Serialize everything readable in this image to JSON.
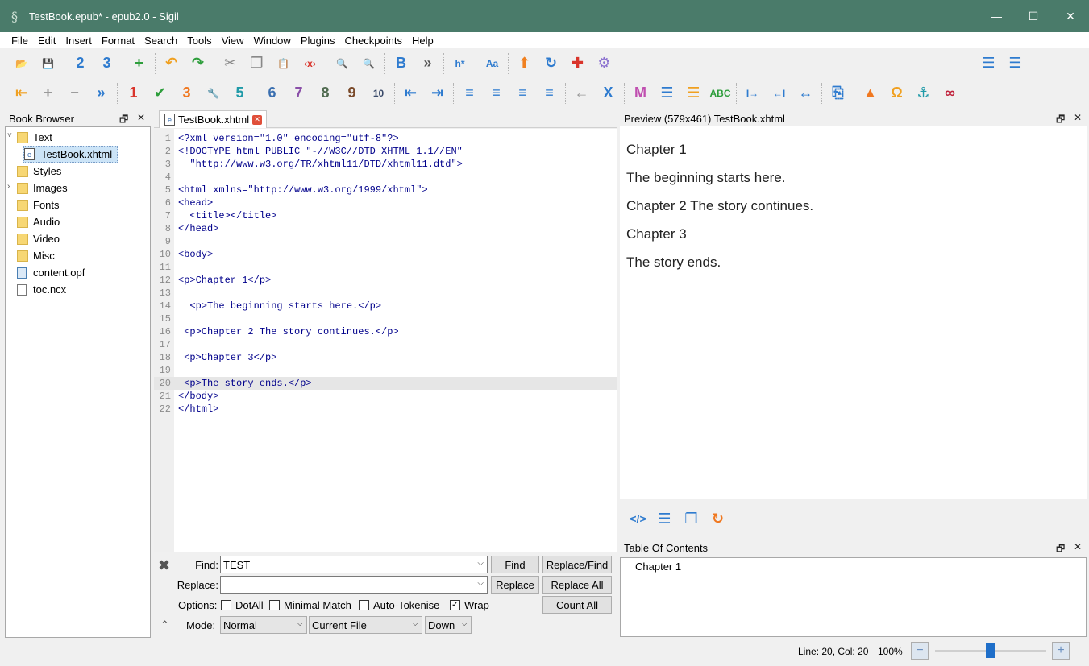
{
  "window": {
    "title": "TestBook.epub* - epub2.0 - Sigil",
    "controls": [
      "—",
      "☐",
      "✕"
    ]
  },
  "menu": [
    "File",
    "Edit",
    "Insert",
    "Format",
    "Search",
    "Tools",
    "View",
    "Window",
    "Plugins",
    "Checkpoints",
    "Help"
  ],
  "toolbar1": [
    {
      "name": "open-folder-icon",
      "glyph": "📂",
      "color": "#f5a623",
      "sep_after": false
    },
    {
      "name": "save-icon",
      "glyph": "💾",
      "color": "#d9342b",
      "sep_after": true
    },
    {
      "name": "epub2-icon",
      "glyph": "2",
      "color": "#2e7bcf",
      "sep_after": false
    },
    {
      "name": "epub3-icon",
      "glyph": "3",
      "color": "#2e7bcf",
      "sep_after": true
    },
    {
      "name": "add-icon",
      "glyph": "+",
      "color": "#2e9e3c",
      "sep_after": true
    },
    {
      "name": "undo-icon",
      "glyph": "↶",
      "color": "#f0a020",
      "sep_after": false
    },
    {
      "name": "redo-icon",
      "glyph": "↷",
      "color": "#2e9e3c",
      "sep_after": true
    },
    {
      "name": "cut-icon",
      "glyph": "✂",
      "color": "#888888",
      "sep_after": false
    },
    {
      "name": "copy-icon",
      "glyph": "❐",
      "color": "#888888",
      "sep_after": false
    },
    {
      "name": "paste-icon",
      "glyph": "📋",
      "color": "#5a7fb0",
      "sep_after": false
    },
    {
      "name": "clear-tags-icon",
      "glyph": "‹x›",
      "color": "#d9342b",
      "sep_after": true
    },
    {
      "name": "search-icon",
      "glyph": "🔍",
      "color": "#2e7bcf",
      "sep_after": false
    },
    {
      "name": "search-heart-icon",
      "glyph": "🔍",
      "color": "#2e7bcf",
      "sep_after": true
    },
    {
      "name": "bold-icon",
      "glyph": "B",
      "color": "#2e7bcf",
      "sep_after": false
    },
    {
      "name": "more-icon",
      "glyph": "»",
      "color": "#555555",
      "sep_after": true
    },
    {
      "name": "heading-icon",
      "glyph": "h*",
      "color": "#2e7bcf",
      "sep_after": true
    },
    {
      "name": "case-icon",
      "glyph": "Aa",
      "color": "#2e7bcf",
      "sep_after": true
    },
    {
      "name": "up-arrow-icon",
      "glyph": "⬆",
      "color": "#f08020",
      "sep_after": false
    },
    {
      "name": "refresh-icon",
      "glyph": "↻",
      "color": "#2e7bcf",
      "sep_after": false
    },
    {
      "name": "split-icon",
      "glyph": "✚",
      "color": "#d9342b",
      "sep_after": false
    },
    {
      "name": "settings-icon",
      "glyph": "⚙",
      "color": "#8a6fcf",
      "sep_after": false
    }
  ],
  "toolbar1_right": [
    {
      "name": "bullet-list-icon",
      "glyph": "☰",
      "color": "#2e7bcf"
    },
    {
      "name": "numbered-list-icon",
      "glyph": "☰",
      "color": "#2e7bcf"
    }
  ],
  "toolbar2": [
    {
      "name": "insert-before-icon",
      "glyph": "⇤",
      "color": "#f0a020",
      "sep_after": false
    },
    {
      "name": "insert-plus-icon",
      "glyph": "+",
      "color": "#999999",
      "sep_after": false
    },
    {
      "name": "insert-minus-icon",
      "glyph": "−",
      "color": "#999999",
      "sep_after": false
    },
    {
      "name": "merge-icon",
      "glyph": "»",
      "color": "#2e7bcf",
      "sep_after": true
    },
    {
      "name": "plugin-1-icon",
      "glyph": "1",
      "color": "#d9342b",
      "sep_after": false
    },
    {
      "name": "validate-icon",
      "glyph": "✔",
      "color": "#2e9e3c",
      "sep_after": false
    },
    {
      "name": "plugin-3-icon",
      "glyph": "3",
      "color": "#f07820",
      "sep_after": false
    },
    {
      "name": "wrench-icon",
      "glyph": "🔧",
      "color": "#2e7bcf",
      "sep_after": false
    },
    {
      "name": "plugin-5-icon",
      "glyph": "5",
      "color": "#1f9aa8",
      "sep_after": true
    },
    {
      "name": "plugin-6-icon",
      "glyph": "6",
      "color": "#3a6fb0",
      "sep_after": false
    },
    {
      "name": "plugin-7-icon",
      "glyph": "7",
      "color": "#8a4fa8",
      "sep_after": false
    },
    {
      "name": "plugin-8-icon",
      "glyph": "8",
      "color": "#4f6a4f",
      "sep_after": false
    },
    {
      "name": "plugin-9-icon",
      "glyph": "9",
      "color": "#7a4a2a",
      "sep_after": false
    },
    {
      "name": "plugin-10-icon",
      "glyph": "10",
      "color": "#3a4a6a",
      "sep_after": true
    },
    {
      "name": "outdent-icon",
      "glyph": "⇤",
      "color": "#2e7bcf",
      "sep_after": false
    },
    {
      "name": "indent-icon",
      "glyph": "⇥",
      "color": "#2e7bcf",
      "sep_after": true
    },
    {
      "name": "align-left-icon",
      "glyph": "≡",
      "color": "#2e7bcf",
      "sep_after": false
    },
    {
      "name": "align-center-icon",
      "glyph": "≡",
      "color": "#2e7bcf",
      "sep_after": false
    },
    {
      "name": "align-right-icon",
      "glyph": "≡",
      "color": "#2e7bcf",
      "sep_after": false
    },
    {
      "name": "align-justify-icon",
      "glyph": "≡",
      "color": "#2e7bcf",
      "sep_after": true
    },
    {
      "name": "back-arrow-icon",
      "glyph": "←",
      "color": "#999999",
      "sep_after": false
    },
    {
      "name": "x-icon",
      "glyph": "X",
      "color": "#2e7bcf",
      "sep_after": true
    },
    {
      "name": "metadata-icon",
      "glyph": "M",
      "color": "#c04fb0",
      "sep_after": false
    },
    {
      "name": "toc-icon",
      "glyph": "☰",
      "color": "#2e7bcf",
      "sep_after": false
    },
    {
      "name": "toc-edit-icon",
      "glyph": "☰",
      "color": "#f0a020",
      "sep_after": false
    },
    {
      "name": "spellcheck-icon",
      "glyph": "ABC",
      "color": "#2e9e3c",
      "sep_after": true
    },
    {
      "name": "cursor-right-icon",
      "glyph": "I→",
      "color": "#2e7bcf",
      "sep_after": false
    },
    {
      "name": "cursor-left-icon",
      "glyph": "←I",
      "color": "#2e7bcf",
      "sep_after": false
    },
    {
      "name": "cursor-split-icon",
      "glyph": "↔",
      "color": "#2e7bcf",
      "sep_after": true
    },
    {
      "name": "page-break-icon",
      "glyph": "⎘",
      "color": "#2e7bcf",
      "sep_after": true
    },
    {
      "name": "image-icon",
      "glyph": "▲",
      "color": "#f07820",
      "sep_after": false
    },
    {
      "name": "omega-icon",
      "glyph": "Ω",
      "color": "#f0a020",
      "sep_after": false
    },
    {
      "name": "anchor-icon",
      "glyph": "⚓",
      "color": "#1f9aa8",
      "sep_after": false
    },
    {
      "name": "link-icon",
      "glyph": "∞",
      "color": "#c0203a",
      "sep_after": false
    }
  ],
  "book_browser": {
    "title": "Book Browser",
    "controls": [
      "🗗",
      "✕"
    ],
    "items": [
      {
        "label": "Text",
        "type": "folder",
        "indent": 0,
        "arrow": "˅"
      },
      {
        "label": "TestBook.xhtml",
        "type": "xhtml",
        "indent": 1,
        "selected": true
      },
      {
        "label": "Styles",
        "type": "folder",
        "indent": 0
      },
      {
        "label": "Images",
        "type": "folder",
        "indent": 0,
        "arrow": "›"
      },
      {
        "label": "Fonts",
        "type": "folder",
        "indent": 0
      },
      {
        "label": "Audio",
        "type": "folder",
        "indent": 0
      },
      {
        "label": "Video",
        "type": "folder",
        "indent": 0
      },
      {
        "label": "Misc",
        "type": "folder",
        "indent": 0
      },
      {
        "label": "content.opf",
        "type": "opf",
        "indent": 0
      },
      {
        "label": "toc.ncx",
        "type": "file",
        "indent": 0
      }
    ]
  },
  "editor": {
    "tab_label": "TestBook.xhtml",
    "highlight_line": 20,
    "lines": [
      "<?xml version=\"1.0\" encoding=\"utf-8\"?>",
      "<!DOCTYPE html PUBLIC \"-//W3C//DTD XHTML 1.1//EN\"",
      "  \"http://www.w3.org/TR/xhtml11/DTD/xhtml11.dtd\">",
      "",
      "<html xmlns=\"http://www.w3.org/1999/xhtml\">",
      "<head>",
      "  <title></title>",
      "</head>",
      "",
      "<body>",
      "",
      "<p>Chapter 1</p>",
      "",
      "  <p>The beginning starts here.</p>",
      "",
      " <p>Chapter 2 The story continues.</p>",
      "",
      " <p>Chapter 3</p>",
      "",
      " <p>The story ends.</p>",
      "</body>",
      "</html>"
    ]
  },
  "find_replace": {
    "find_label": "Find:",
    "find_value": "TEST",
    "replace_label": "Replace:",
    "replace_value": "",
    "options_label": "Options:",
    "mode_label": "Mode:",
    "buttons": {
      "find": "Find",
      "replace_find": "Replace/Find",
      "replace": "Replace",
      "replace_all": "Replace All",
      "count_all": "Count All"
    },
    "options": [
      {
        "label": "DotAll",
        "checked": false
      },
      {
        "label": "Minimal Match",
        "checked": false
      },
      {
        "label": "Auto-Tokenise",
        "checked": false
      },
      {
        "label": "Wrap",
        "checked": true
      }
    ],
    "mode_value": "Normal",
    "scope_value": "Current File",
    "direction_value": "Down",
    "close_glyph": "✖",
    "collapse_glyph": "⌃"
  },
  "preview": {
    "title": "Preview (579x461) TestBook.xhtml",
    "controls": [
      "🗗",
      "✕"
    ],
    "paragraphs": [
      "Chapter 1",
      "The beginning starts here.",
      "Chapter 2 The story continues.",
      "Chapter 3",
      "The story ends."
    ],
    "icons": [
      {
        "name": "code-view-icon",
        "glyph": "</>",
        "color": "#2e7bcf"
      },
      {
        "name": "select-all-icon",
        "glyph": "☰",
        "color": "#2e7bcf"
      },
      {
        "name": "copy-preview-icon",
        "glyph": "❐",
        "color": "#2e7bcf"
      },
      {
        "name": "reload-icon",
        "glyph": "↻",
        "color": "#f07820"
      }
    ]
  },
  "toc": {
    "title": "Table Of Contents",
    "controls": [
      "🗗",
      "✕"
    ],
    "entries": [
      "Chapter 1"
    ]
  },
  "status": {
    "position": "Line: 20, Col: 20",
    "zoom": "100%",
    "zoom_out": "−",
    "zoom_in": "+",
    "zoom_fraction": 0.5
  }
}
